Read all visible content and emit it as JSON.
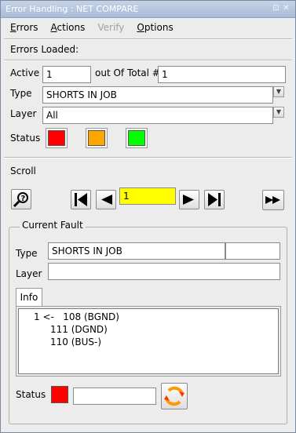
{
  "window": {
    "title": "Error Handling : NET COMPARE",
    "buttons": [
      "restore",
      "close"
    ]
  },
  "menu": {
    "errors": {
      "label": "Errors",
      "mnemonic": "E",
      "rest": "rrors"
    },
    "actions": {
      "label": "Actions",
      "mnemonic": "A",
      "rest": "ctions"
    },
    "verify": {
      "label": "Verify",
      "disabled": true
    },
    "options": {
      "label": "Options",
      "mnemonic": "O",
      "rest": "ptions"
    }
  },
  "errors_loaded_label": "Errors Loaded:",
  "filter": {
    "active_label": "Active",
    "active_value": "1",
    "total_label": "out Of Total #",
    "total_value": "1",
    "type_label": "Type",
    "type_value": "SHORTS IN JOB",
    "layer_label": "Layer",
    "layer_value": "All",
    "status_label": "Status",
    "status_colors": [
      "#ff0000",
      "#ffa500",
      "#00ff00"
    ]
  },
  "scroll": {
    "label": "Scroll",
    "current_index": "1",
    "index_field_color": "#ffff00",
    "icons": {
      "help": "help-query-icon",
      "first": "first-icon",
      "prev": "previous-icon",
      "next": "next-icon",
      "last": "last-icon",
      "fast_forward": "fast-forward-icon"
    }
  },
  "current_fault": {
    "group_title": "Current Fault",
    "type_label": "Type",
    "type_value": "SHORTS IN JOB",
    "type_extra": "",
    "layer_label": "Layer",
    "layer_value": "",
    "tab_info": "Info",
    "info_lines": [
      "1 <-   108 (BGND)",
      "111 (DGND)",
      "110 (BUS-)"
    ],
    "status_label": "Status",
    "status_color": "#ff0000",
    "status_text": "",
    "refresh_icon": "refresh-cycle-icon"
  }
}
